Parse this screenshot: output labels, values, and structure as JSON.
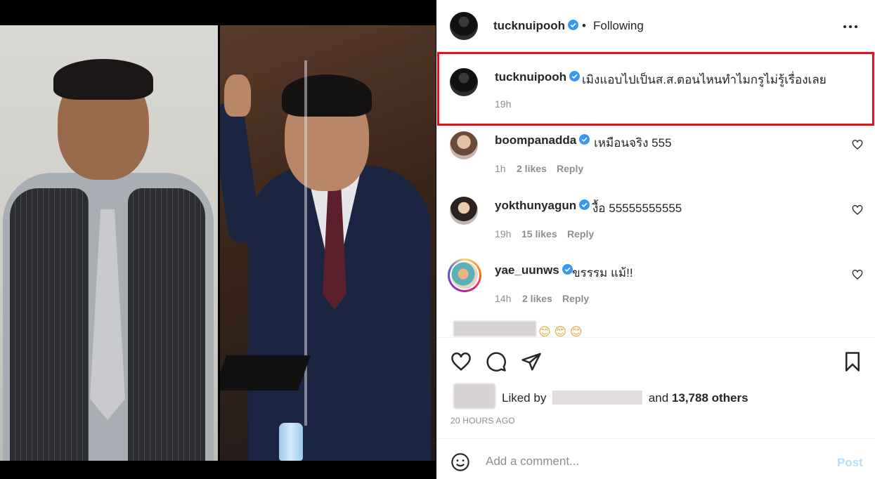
{
  "header": {
    "username": "tucknuipooh",
    "separator": "•",
    "follow_label": "Following",
    "more_label": "•••"
  },
  "caption": {
    "username": "tucknuipooh",
    "text": "เมิงแอบไปเป็นส.ส.ตอนไหนทำไมกรูไม่รู้เรื่องเลย",
    "time": "19h"
  },
  "comments": [
    {
      "username": "boompanadda",
      "text": "เหมือนจริง 555",
      "time": "1h",
      "likes": "2 likes",
      "reply": "Reply"
    },
    {
      "username": "yokthunyagun",
      "text": "งื้อ 55555555555",
      "time": "19h",
      "likes": "15 likes",
      "reply": "Reply"
    },
    {
      "username": "yae_uunws",
      "text": "ขรรรม แม้!!",
      "time": "14h",
      "likes": "2 likes",
      "reply": "Reply"
    }
  ],
  "partial_comment_emojis": "😊 😊 😊",
  "footer": {
    "liked_by_prefix": "Liked by",
    "liked_by_and": "and",
    "others": "13,788 others",
    "posted_ago": "20 HOURS AGO",
    "comment_placeholder": "Add a comment...",
    "post_label": "Post"
  },
  "colors": {
    "verified": "#3897f0",
    "highlight": "#e0141e",
    "post_disabled": "#b2dffc"
  },
  "icons": [
    "verified-icon",
    "more-icon",
    "heart-icon",
    "comment-icon",
    "share-icon",
    "bookmark-icon",
    "emoji-icon"
  ]
}
